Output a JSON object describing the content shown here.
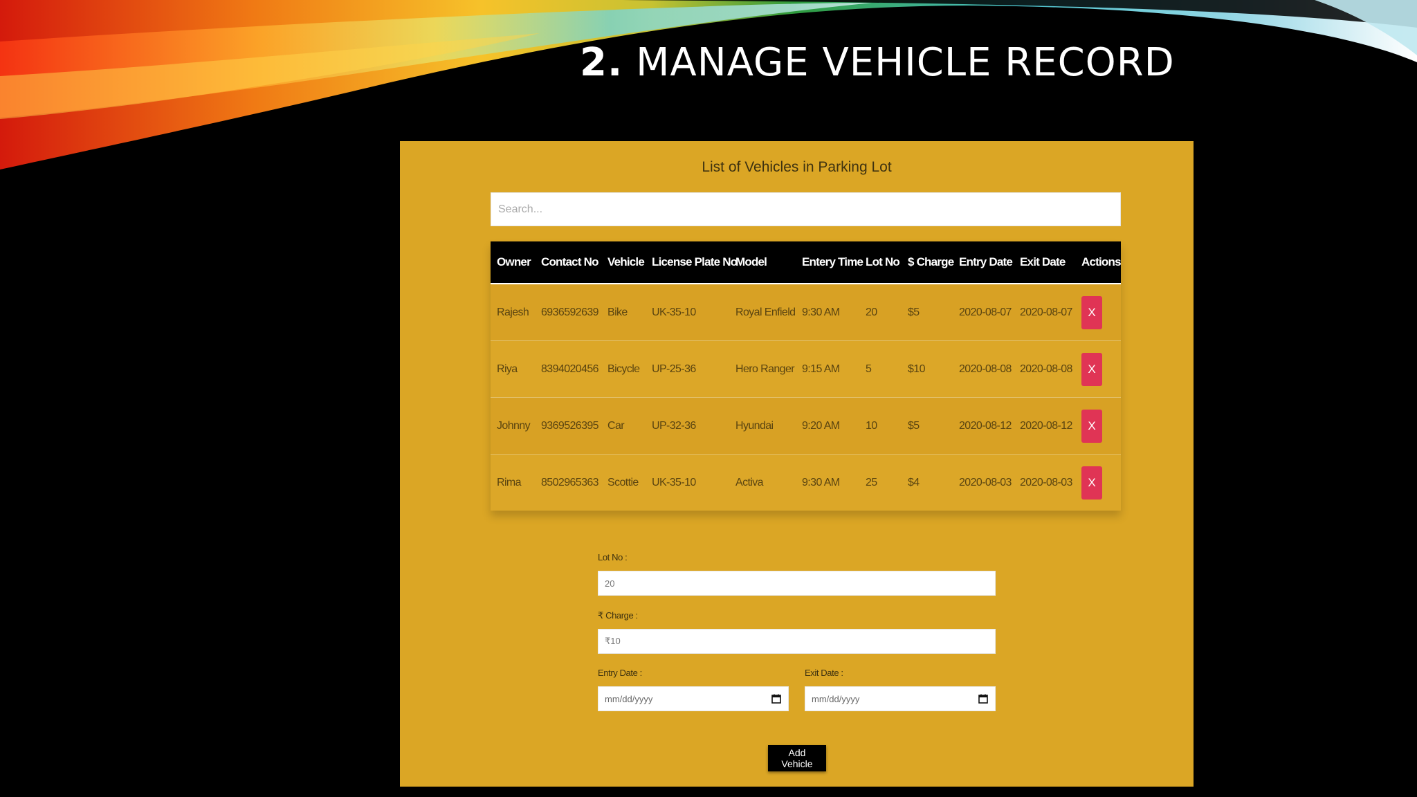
{
  "slide": {
    "number": "2.",
    "title": "MANAGE VEHICLE RECORD"
  },
  "app": {
    "heading": "List of Vehicles in Parking Lot",
    "search": {
      "placeholder": "Search...",
      "value": ""
    },
    "table": {
      "columns": [
        "Owner",
        "Contact No",
        "Vehicle",
        "License Plate No",
        "Model",
        "Entery Time",
        "Lot No",
        "$ Charge",
        "Entry Date",
        "Exit Date",
        "Actions"
      ],
      "rows": [
        {
          "owner": "Rajesh",
          "contact": "6936592639",
          "vehicle": "Bike",
          "plate": "UK-35-10",
          "model": "Royal Enfield",
          "entry_time": "9:30 AM",
          "lot": "20",
          "charge": "$5",
          "entry_date": "2020-08-07",
          "exit_date": "2020-08-07",
          "action": "X"
        },
        {
          "owner": "Riya",
          "contact": "8394020456",
          "vehicle": "Bicycle",
          "plate": "UP-25-36",
          "model": "Hero Ranger",
          "entry_time": "9:15 AM",
          "lot": "5",
          "charge": "$10",
          "entry_date": "2020-08-08",
          "exit_date": "2020-08-08",
          "action": "X"
        },
        {
          "owner": "Johnny",
          "contact": "9369526395",
          "vehicle": "Car",
          "plate": "UP-32-36",
          "model": "Hyundai",
          "entry_time": "9:20 AM",
          "lot": "10",
          "charge": "$5",
          "entry_date": "2020-08-12",
          "exit_date": "2020-08-12",
          "action": "X"
        },
        {
          "owner": "Rima",
          "contact": "8502965363",
          "vehicle": "Scottie",
          "plate": "UK-35-10",
          "model": "Activa",
          "entry_time": "9:30 AM",
          "lot": "25",
          "charge": "$4",
          "entry_date": "2020-08-03",
          "exit_date": "2020-08-03",
          "action": "X"
        }
      ]
    },
    "form": {
      "lot_label": "Lot No :",
      "lot_value": "20",
      "charge_label": "₹ Charge :",
      "charge_value": "₹10",
      "entry_date_label": "Entry Date :",
      "entry_date_placeholder": "mm/dd/yyyy",
      "exit_date_label": "Exit Date :",
      "exit_date_placeholder": "mm/dd/yyyy",
      "submit_label": "Add Vehicle"
    }
  },
  "colors": {
    "panel_bg": "#dba625",
    "header_bg": "#000000",
    "delete_button": "#e03455",
    "page_bg": "#000000"
  },
  "icons": {
    "date_picker": "calendar-icon"
  }
}
